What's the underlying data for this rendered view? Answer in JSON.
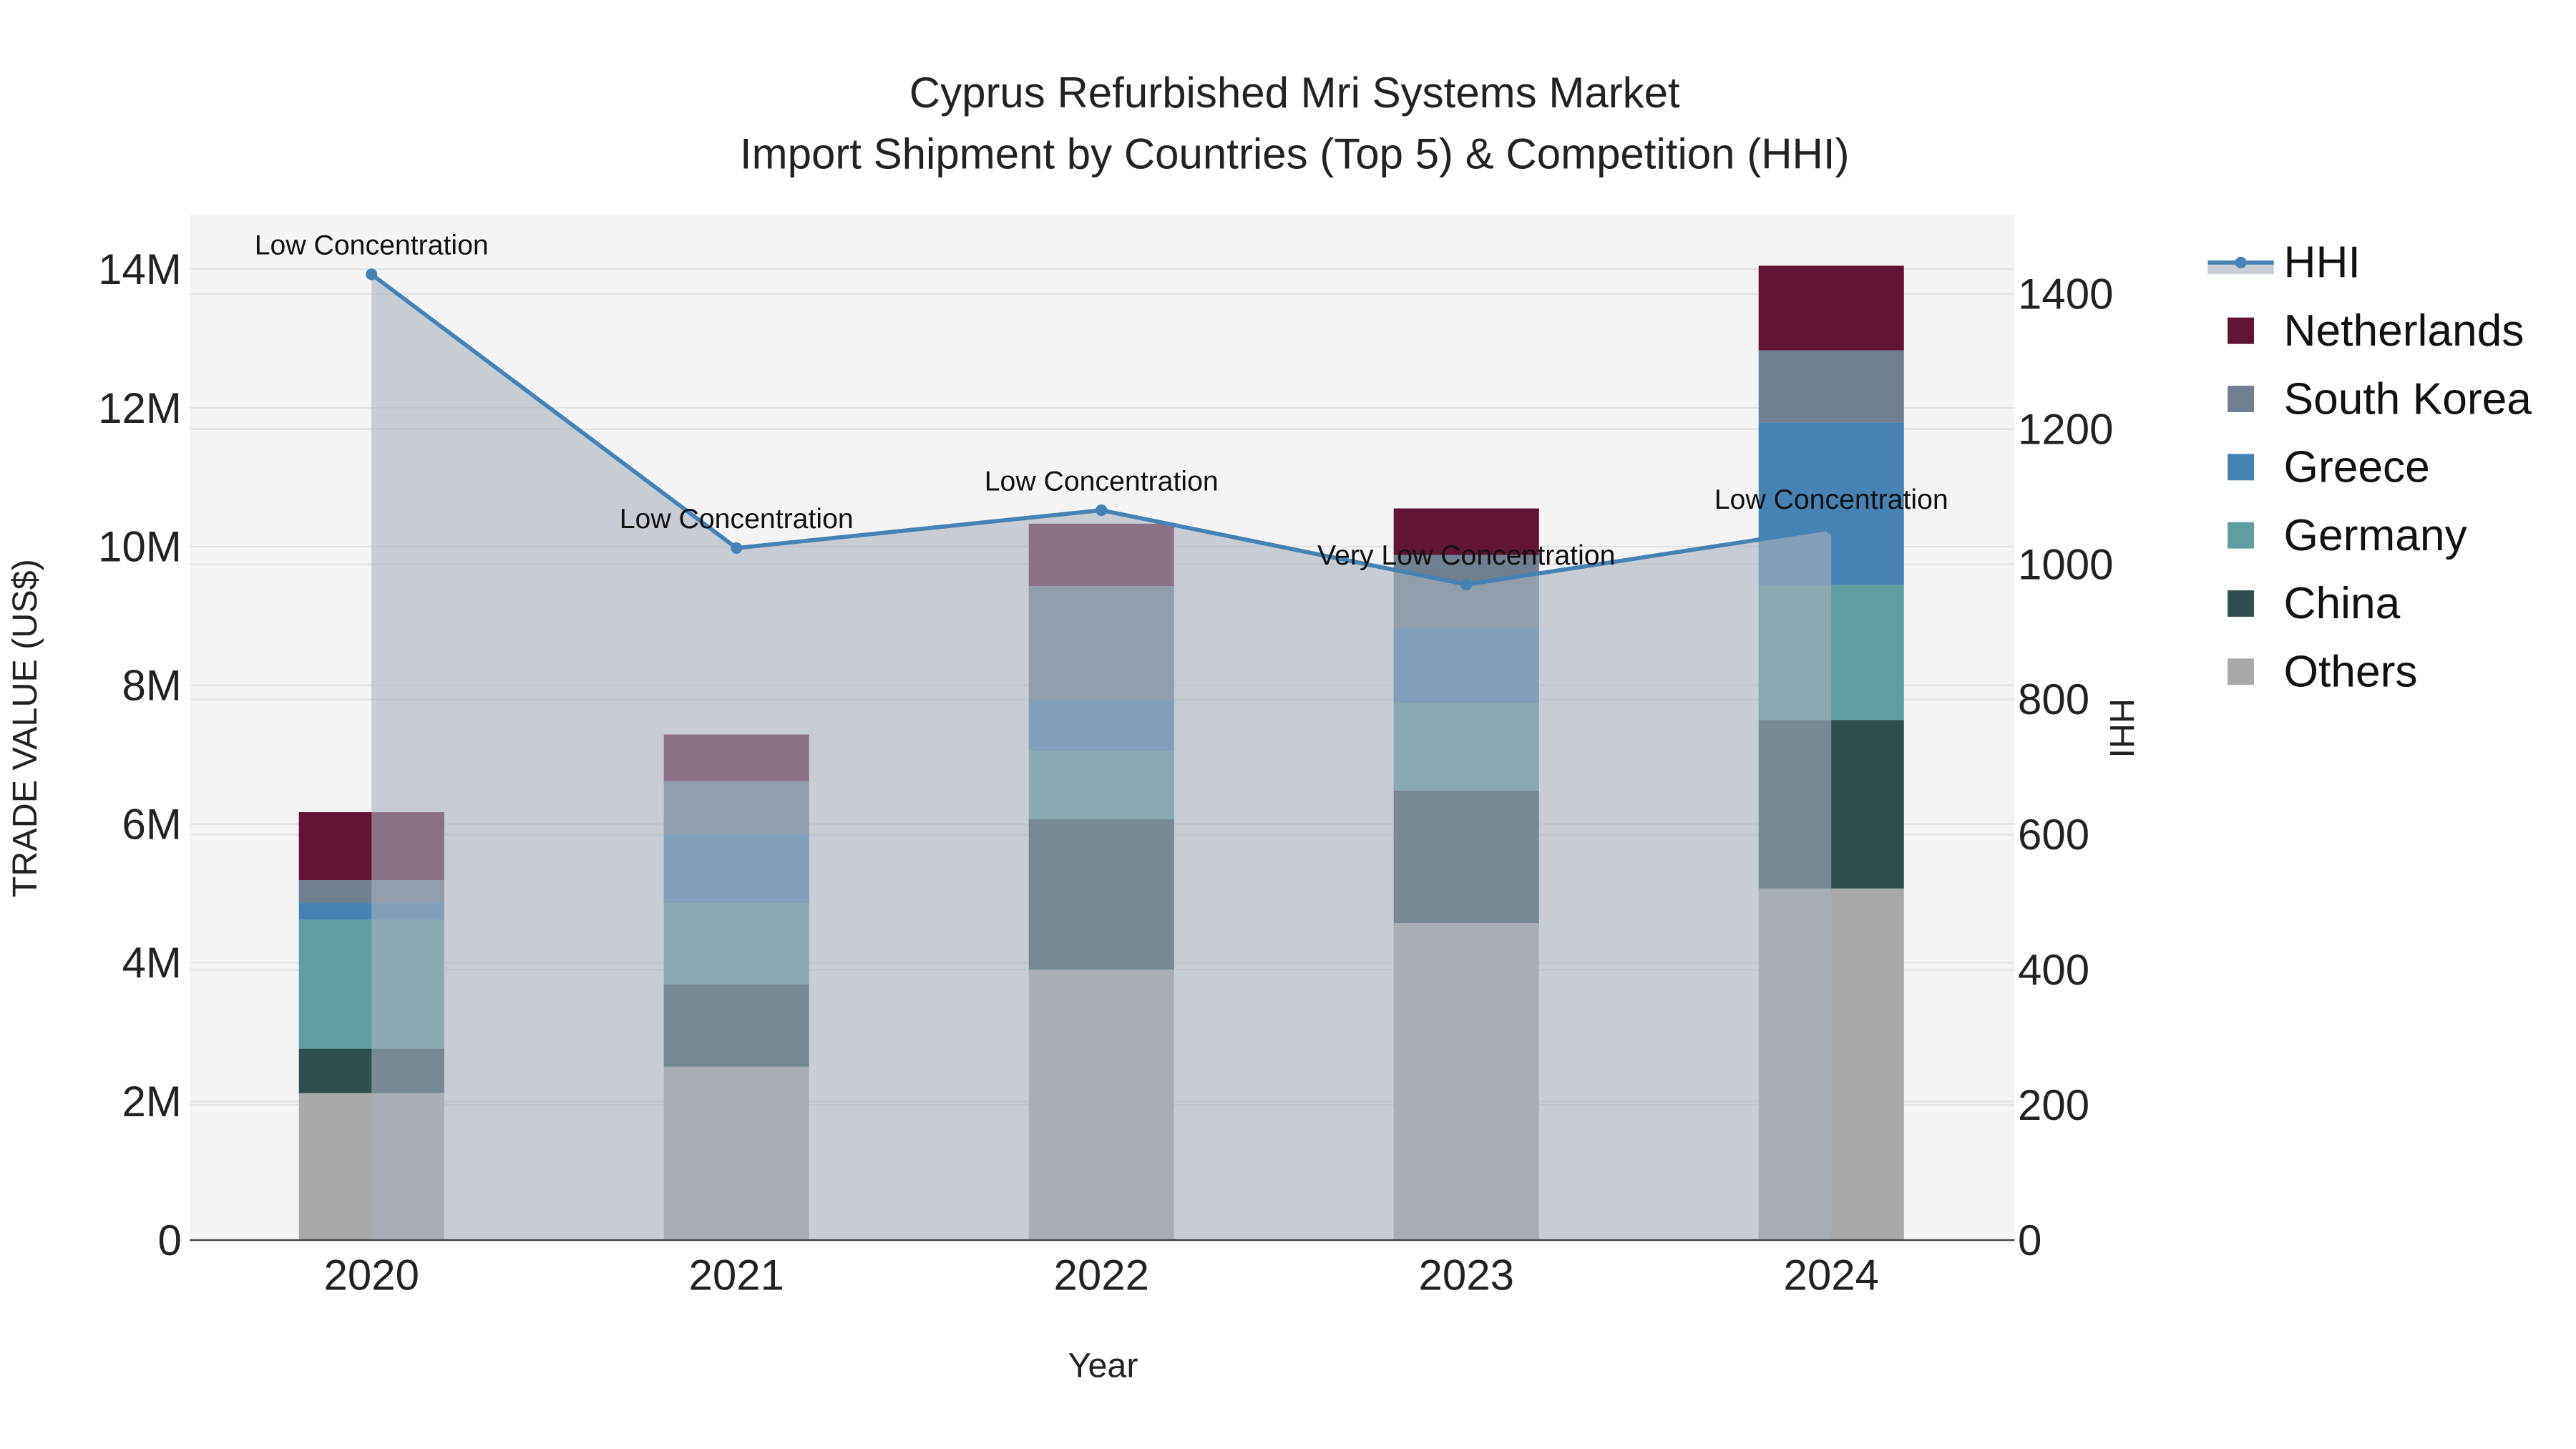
{
  "chart_data": {
    "type": "bar",
    "stacked": true,
    "title": "Cyprus Refurbished Mri Systems Market",
    "subtitle": "Import Shipment by Countries (Top 5) & Competition (HHI)",
    "xlabel": "Year",
    "ylabel": "TRADE VALUE (US$)",
    "y2label": "HHI",
    "categories": [
      "2020",
      "2021",
      "2022",
      "2023",
      "2024"
    ],
    "ylim": [
      0,
      14800000
    ],
    "y2lim": [
      0,
      1515
    ],
    "yticks": [
      0,
      2000000,
      4000000,
      6000000,
      8000000,
      10000000,
      12000000,
      14000000
    ],
    "ytick_labels": [
      "0",
      "2M",
      "4M",
      "6M",
      "8M",
      "10M",
      "12M",
      "14M"
    ],
    "y2ticks": [
      0,
      200,
      400,
      600,
      800,
      1000,
      1200,
      1400
    ],
    "y2tick_labels": [
      "0",
      "200",
      "400",
      "600",
      "800",
      "1000",
      "1200",
      "1400"
    ],
    "grid": true,
    "legend_position": "right",
    "series": [
      {
        "name": "Others",
        "color": "#a9a9a9",
        "values": [
          2120000,
          2500000,
          3900000,
          4570000,
          5070000
        ]
      },
      {
        "name": "China",
        "color": "#2f4f4f",
        "values": [
          640000,
          1190000,
          2170000,
          1910000,
          2430000
        ]
      },
      {
        "name": "Germany",
        "color": "#5f9ea0",
        "values": [
          1860000,
          1170000,
          980000,
          1260000,
          1950000
        ]
      },
      {
        "name": "Greece",
        "color": "#4682b4",
        "values": [
          240000,
          1000000,
          740000,
          1090000,
          2340000
        ]
      },
      {
        "name": "South Korea",
        "color": "#708090",
        "values": [
          330000,
          760000,
          1640000,
          1050000,
          1040000
        ]
      },
      {
        "name": "Netherlands",
        "color": "#611434",
        "values": [
          980000,
          670000,
          900000,
          670000,
          1220000
        ]
      }
    ],
    "line": {
      "name": "HHI",
      "color": "#4682b4",
      "values": [
        1429,
        1024,
        1080,
        970,
        1053
      ],
      "annotations": [
        "Low Concentration",
        "Low Concentration",
        "Low Concentration",
        "Very Low Concentration",
        "Low Concentration"
      ]
    },
    "legend_order": [
      "HHI",
      "Netherlands",
      "South Korea",
      "Greece",
      "Germany",
      "China",
      "Others"
    ]
  }
}
